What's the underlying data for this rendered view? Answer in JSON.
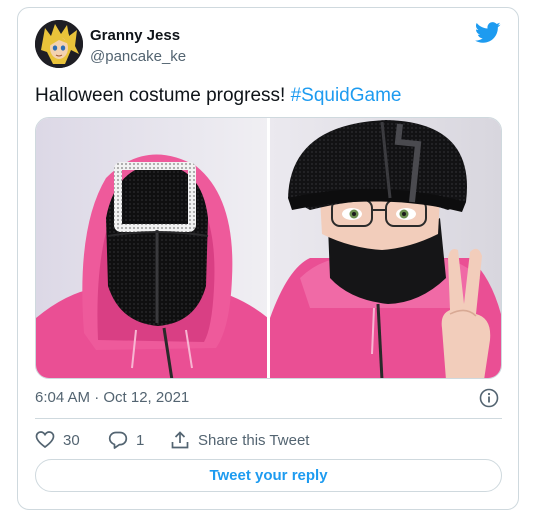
{
  "author": {
    "display_name": "Granny Jess",
    "handle": "@pancake_ke"
  },
  "tweet": {
    "text": "Halloween costume progress! ",
    "hashtag": "#SquidGame"
  },
  "timestamp": "6:04 AM · Oct 12, 2021",
  "actions": {
    "likes": "30",
    "replies": "1",
    "share_label": "Share this Tweet"
  },
  "reply_button_label": "Tweet your reply",
  "colors": {
    "accent": "#1d9bf0",
    "secondary_text": "#536471",
    "border": "#cfd9de",
    "hoodie_pink": "#ec4c93"
  },
  "icons": [
    "twitter-bird-icon",
    "info-icon",
    "heart-icon",
    "reply-icon",
    "share-icon"
  ]
}
